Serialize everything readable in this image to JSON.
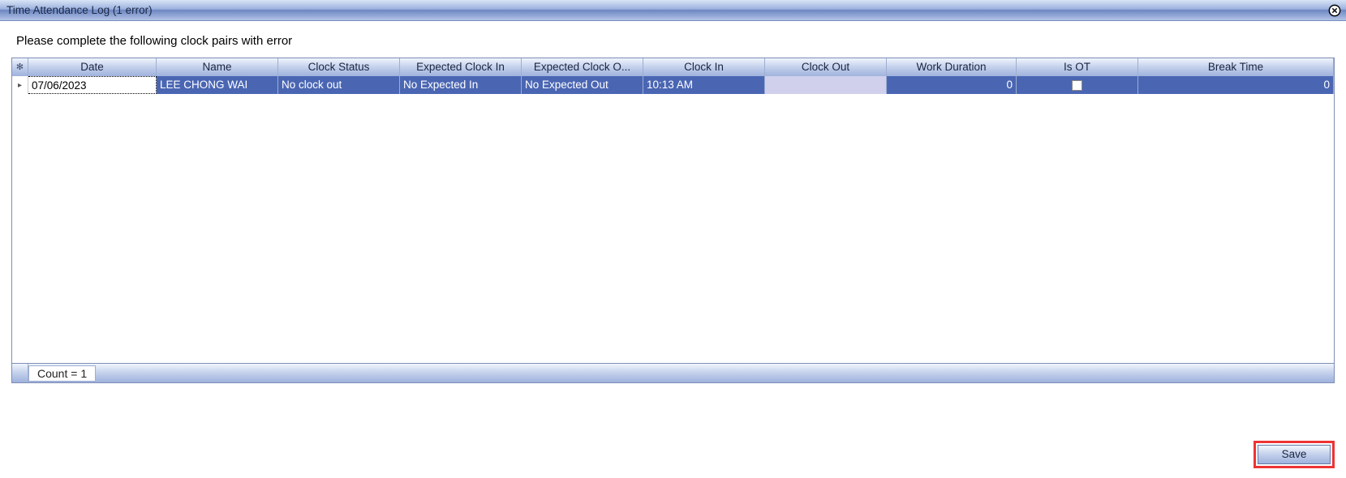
{
  "window": {
    "title": "Time Attendance Log (1 error)"
  },
  "instruction": "Please complete the following clock pairs with error",
  "grid": {
    "headers": {
      "date": "Date",
      "name": "Name",
      "clock_status": "Clock Status",
      "expected_in": "Expected Clock In",
      "expected_out": "Expected Clock O...",
      "clock_in": "Clock In",
      "clock_out": "Clock Out",
      "work_duration": "Work Duration",
      "is_ot": "Is OT",
      "break_time": "Break Time"
    },
    "rows": [
      {
        "date": "07/06/2023",
        "name": "LEE CHONG WAI",
        "clock_status": "No clock out",
        "expected_in": "No Expected In",
        "expected_out": "No Expected Out",
        "clock_in": "10:13 AM",
        "clock_out": "",
        "work_duration": "0",
        "is_ot": false,
        "break_time": "0"
      }
    ],
    "footer": {
      "count_label": "Count = 1"
    }
  },
  "buttons": {
    "save": "Save"
  },
  "icons": {
    "selector_corner": "✻",
    "row_indicator": "▸"
  }
}
